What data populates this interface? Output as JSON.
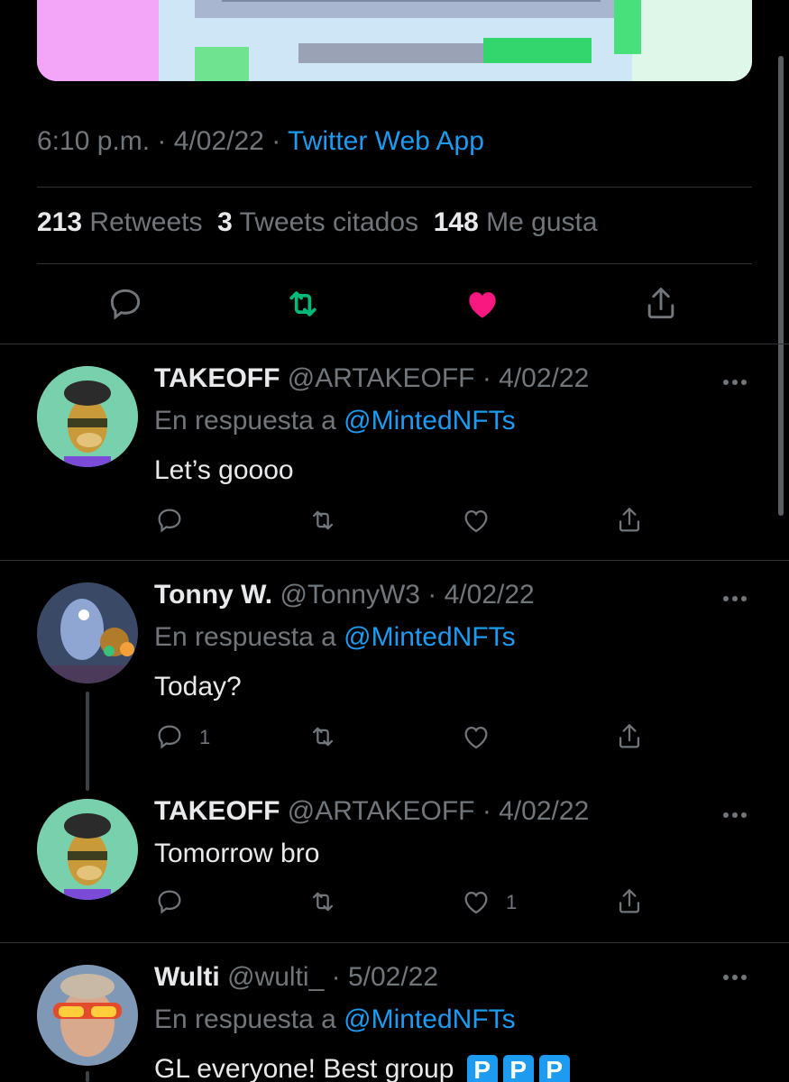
{
  "tweet": {
    "time": "6:10 p.m.",
    "date": "4/02/22",
    "source": "Twitter Web App",
    "sep": "·",
    "stats": {
      "retweets_count": "213",
      "retweets_label": "Retweets",
      "quotes_count": "3",
      "quotes_label": "Tweets citados",
      "likes_count": "148",
      "likes_label": "Me gusta"
    },
    "actions": [
      "reply-icon",
      "retweet-icon",
      "like-icon",
      "share-icon"
    ],
    "colors": {
      "retweet": "#00ba7c",
      "like": "#f91880",
      "link": "#1d9bf0",
      "muted": "#71767b"
    }
  },
  "replies": [
    {
      "name": "TAKEOFF",
      "handle": "@ARTAKEOFF",
      "date": "4/02/22",
      "in_reply_prefix": "En respuesta a",
      "in_reply_mention": "@MintedNFTs",
      "text": "Let’s goooo",
      "reply_count": "",
      "like_count": ""
    },
    {
      "name": "Tonny W.",
      "handle": "@TonnyW3",
      "date": "4/02/22",
      "in_reply_prefix": "En respuesta a",
      "in_reply_mention": "@MintedNFTs",
      "text": "Today?",
      "reply_count": "1",
      "like_count": ""
    },
    {
      "name": "TAKEOFF",
      "handle": "@ARTAKEOFF",
      "date": "4/02/22",
      "text": "Tomorrow bro",
      "reply_count": "",
      "like_count": "1"
    },
    {
      "name": "Wulti",
      "handle": "@wulti_",
      "date": "5/02/22",
      "in_reply_prefix": "En respuesta a",
      "in_reply_mention": "@MintedNFTs",
      "text": "GL everyone! Best group",
      "badges": [
        "P",
        "P",
        "P"
      ]
    }
  ]
}
